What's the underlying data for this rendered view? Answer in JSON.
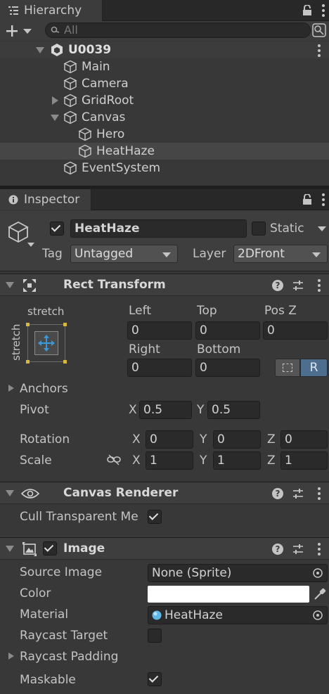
{
  "hierarchy": {
    "tab_label": "Hierarchy",
    "search_placeholder": "All",
    "scene_name": "U0039",
    "items": [
      {
        "label": "Main"
      },
      {
        "label": "Camera"
      },
      {
        "label": "GridRoot"
      },
      {
        "label": "Canvas"
      },
      {
        "label": "Hero"
      },
      {
        "label": "HeatHaze"
      },
      {
        "label": "EventSystem"
      }
    ]
  },
  "inspector": {
    "tab_label": "Inspector",
    "object_name": "HeatHaze",
    "static_label": "Static",
    "tag_label": "Tag",
    "tag_value": "Untagged",
    "layer_label": "Layer",
    "layer_value": "2DFront"
  },
  "rect_transform": {
    "title": "Rect Transform",
    "anchor_top_label": "stretch",
    "anchor_side_label": "stretch",
    "left_label": "Left",
    "left_value": "0",
    "top_label": "Top",
    "top_value": "0",
    "posz_label": "Pos Z",
    "posz_value": "0",
    "right_label": "Right",
    "right_value": "0",
    "bottom_label": "Bottom",
    "bottom_value": "0",
    "r_button": "R",
    "anchors_label": "Anchors",
    "pivot_label": "Pivot",
    "pivot_x_label": "X",
    "pivot_x": "0.5",
    "pivot_y_label": "Y",
    "pivot_y": "0.5",
    "rotation_label": "Rotation",
    "rot_x_label": "X",
    "rot_x": "0",
    "rot_y_label": "Y",
    "rot_y": "0",
    "rot_z_label": "Z",
    "rot_z": "0",
    "scale_label": "Scale",
    "scale_x_label": "X",
    "scale_x": "1",
    "scale_y_label": "Y",
    "scale_y": "1",
    "scale_z_label": "Z",
    "scale_z": "1"
  },
  "canvas_renderer": {
    "title": "Canvas Renderer",
    "cull_label": "Cull Transparent Me"
  },
  "image": {
    "title": "Image",
    "source_image_label": "Source Image",
    "source_image_value": "None (Sprite)",
    "color_label": "Color",
    "material_label": "Material",
    "material_value": "HeatHaze",
    "raycast_target_label": "Raycast Target",
    "raycast_padding_label": "Raycast Padding",
    "maskable_label": "Maskable"
  },
  "colors": {
    "background": "#383838",
    "selected_row": "#464646",
    "header": "#3e3e3e",
    "accent_blue": "#4d6e8f"
  }
}
